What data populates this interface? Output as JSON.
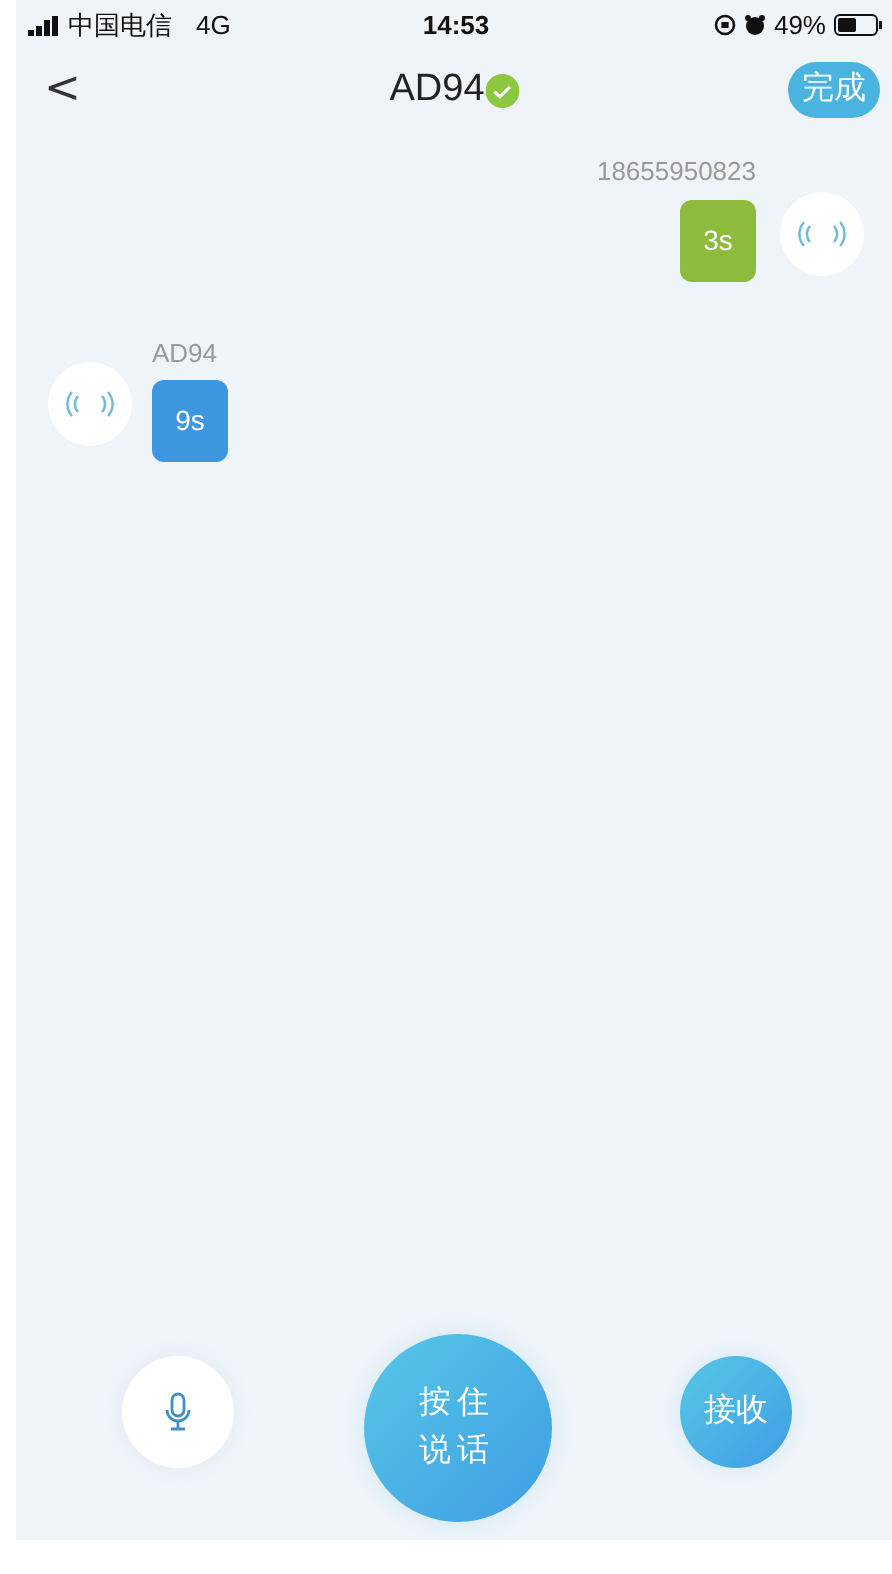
{
  "status_bar": {
    "carrier": "中国电信",
    "network": "4G",
    "time": "14:53",
    "battery": "49%"
  },
  "nav": {
    "back": "<",
    "title": "AD94",
    "verified": true,
    "done_button": "完成"
  },
  "messages": [
    {
      "kind": "sent",
      "sender": "18655950823",
      "duration": "3s",
      "color": "#8dbb3c"
    },
    {
      "kind": "received",
      "sender": "AD94",
      "duration": "9s",
      "color": "#3d96e0"
    }
  ],
  "controls": {
    "talk_button": "按住说话",
    "receive_button": "接收"
  }
}
